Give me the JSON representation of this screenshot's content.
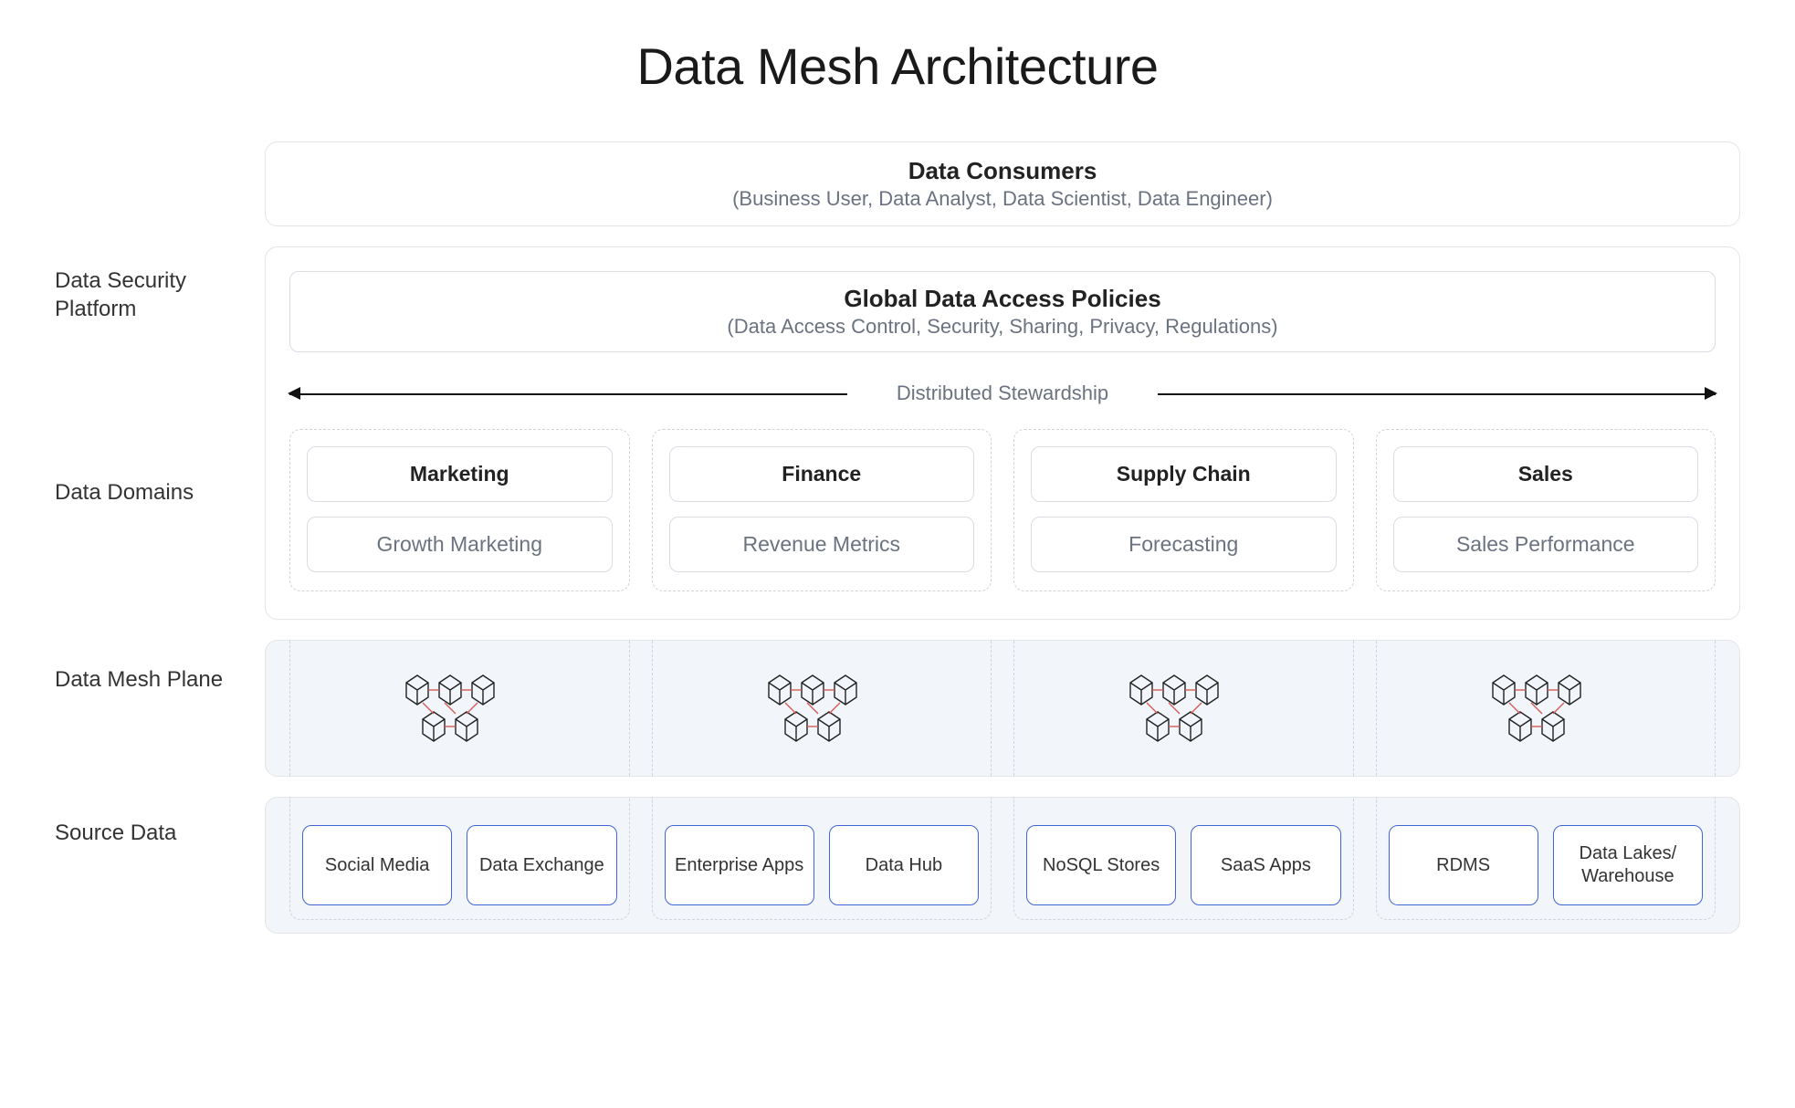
{
  "title": "Data Mesh Architecture",
  "left_labels": {
    "security": "Data Security Platform",
    "domains": "Data Domains",
    "mesh": "Data Mesh Plane",
    "source": "Source Data"
  },
  "consumers": {
    "heading": "Data Consumers",
    "sub": "(Business User, Data Analyst, Data Scientist, Data Engineer)"
  },
  "policies": {
    "heading": "Global Data Access Policies",
    "sub": "(Data Access Control, Security, Sharing, Privacy, Regulations)"
  },
  "stewardship_label": "Distributed Stewardship",
  "domains": [
    {
      "name": "Marketing",
      "sub": "Growth Marketing"
    },
    {
      "name": "Finance",
      "sub": "Revenue Metrics"
    },
    {
      "name": "Supply Chain",
      "sub": "Forecasting"
    },
    {
      "name": "Sales",
      "sub": "Sales Performance"
    }
  ],
  "source_data": [
    [
      "Social Media",
      "Data Exchange"
    ],
    [
      "Enterprise Apps",
      "Data Hub"
    ],
    [
      "NoSQL Stores",
      "SaaS Apps"
    ],
    [
      "RDMS",
      "Data Lakes/ Warehouse"
    ]
  ],
  "icons": {
    "mesh_icon_name": "mesh-cubes-icon"
  },
  "colors": {
    "border": "#e3e5e9",
    "border_inner": "#d9dce2",
    "dashed": "#cfd3da",
    "light_bg": "#f2f5f9",
    "src_border": "#3e66d6",
    "muted_text": "#6b7280",
    "text": "#1a1a1a"
  }
}
